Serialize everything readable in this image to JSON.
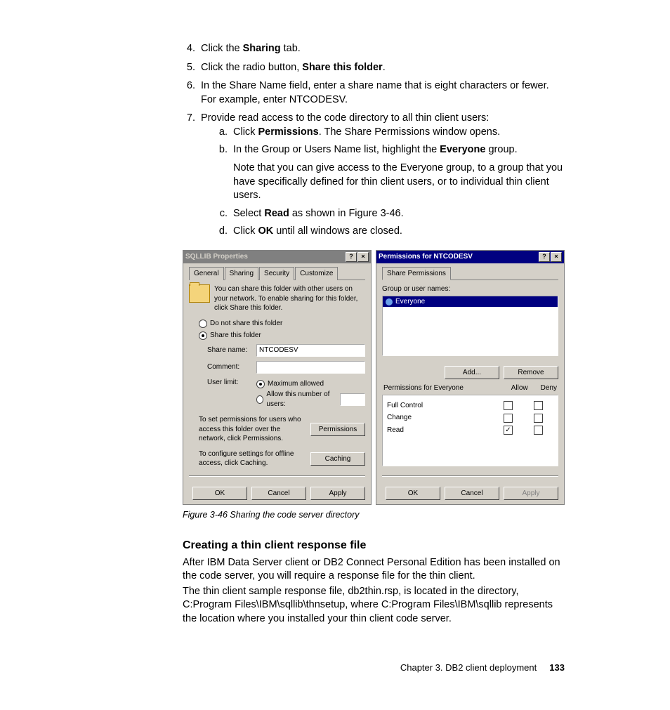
{
  "steps": {
    "s4_pre": "Click the ",
    "s4_b": "Sharing",
    "s4_post": " tab.",
    "s5_pre": "Click the radio button, ",
    "s5_b": "Share this folder",
    "s5_post": ".",
    "s6": "In the Share Name field, enter a share name that is eight characters or fewer. For example, enter NTCODESV.",
    "s7": "Provide read access to the code directory to all thin client users:",
    "s7a_pre": "Click ",
    "s7a_b": "Permissions",
    "s7a_post": ". The Share Permissions window opens.",
    "s7b_pre": "In the Group or Users Name list, highlight the ",
    "s7b_b": "Everyone",
    "s7b_post": " group.",
    "s7b_note": "Note that you can give access to the Everyone group, to a group that you have specifically defined for thin client users, or to individual thin client users.",
    "s7c_pre": "Select ",
    "s7c_b": "Read",
    "s7c_post": " as shown in Figure 3-46.",
    "s7d_pre": "Click ",
    "s7d_b": "OK",
    "s7d_post": " until all windows are closed."
  },
  "figure_caption": "Figure 3-46   Sharing the code server directory",
  "heading": "Creating a thin client response file",
  "body_p1": "After IBM Data Server client or DB2 Connect Personal Edition has been installed on the code server, you will require a response file for the thin client.",
  "body_p2": "The thin client sample response file, db2thin.rsp, is located in the directory, C:Program Files\\IBM\\sqllib\\thnsetup, where C:Program Files\\IBM\\sqllib represents the location where you installed your thin client code server.",
  "footer_chapter": "Chapter 3. DB2 client deployment",
  "footer_page": "133",
  "dlg_left": {
    "title": "SQLLIB Properties",
    "tabs": {
      "general": "General",
      "sharing": "Sharing",
      "security": "Security",
      "customize": "Customize"
    },
    "info": "You can share this folder with other users on your network. To enable sharing for this folder, click Share this folder.",
    "radio_noshare": "Do not share this folder",
    "radio_share": "Share this folder",
    "lbl_share": "Share name:",
    "val_share": "NTCODESV",
    "lbl_comment": "Comment:",
    "lbl_userlimit": "User limit:",
    "radio_max": "Maximum allowed",
    "radio_allow": "Allow this number of users:",
    "perm_text": "To set permissions for users who access this folder over the network, click Permissions.",
    "btn_perm": "Permissions",
    "cache_text": "To configure settings for offline access, click Caching.",
    "btn_cache": "Caching",
    "btn_ok": "OK",
    "btn_cancel": "Cancel",
    "btn_apply": "Apply"
  },
  "dlg_right": {
    "title": "Permissions for NTCODESV",
    "tab": "Share Permissions",
    "grp_label": "Group or user names:",
    "item": "Everyone",
    "btn_add": "Add...",
    "btn_remove": "Remove",
    "perm_for": "Permissions for Everyone",
    "col_allow": "Allow",
    "col_deny": "Deny",
    "perm_full": "Full Control",
    "perm_change": "Change",
    "perm_read": "Read",
    "btn_ok": "OK",
    "btn_cancel": "Cancel",
    "btn_apply": "Apply"
  }
}
